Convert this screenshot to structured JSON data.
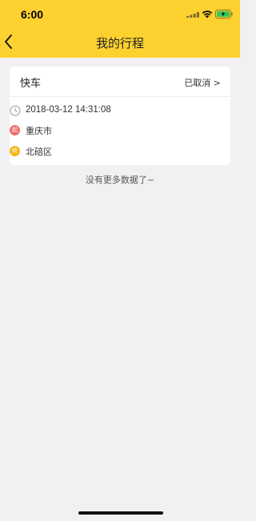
{
  "status_bar": {
    "time": "6:00"
  },
  "nav": {
    "title": "我的行程"
  },
  "trip": {
    "type": "快车",
    "status": "已取消 >",
    "time": "2018-03-12 14:31:08",
    "start_badge": "起",
    "start": "重庆市",
    "end_badge": "终",
    "end": "北碚区"
  },
  "list": {
    "end_message": "没有更多数据了~"
  },
  "colors": {
    "header_bg": "#fdd130",
    "page_bg": "#f1f1f3",
    "start_dot": "#ef6d6d",
    "end_dot": "#f5b71d"
  }
}
